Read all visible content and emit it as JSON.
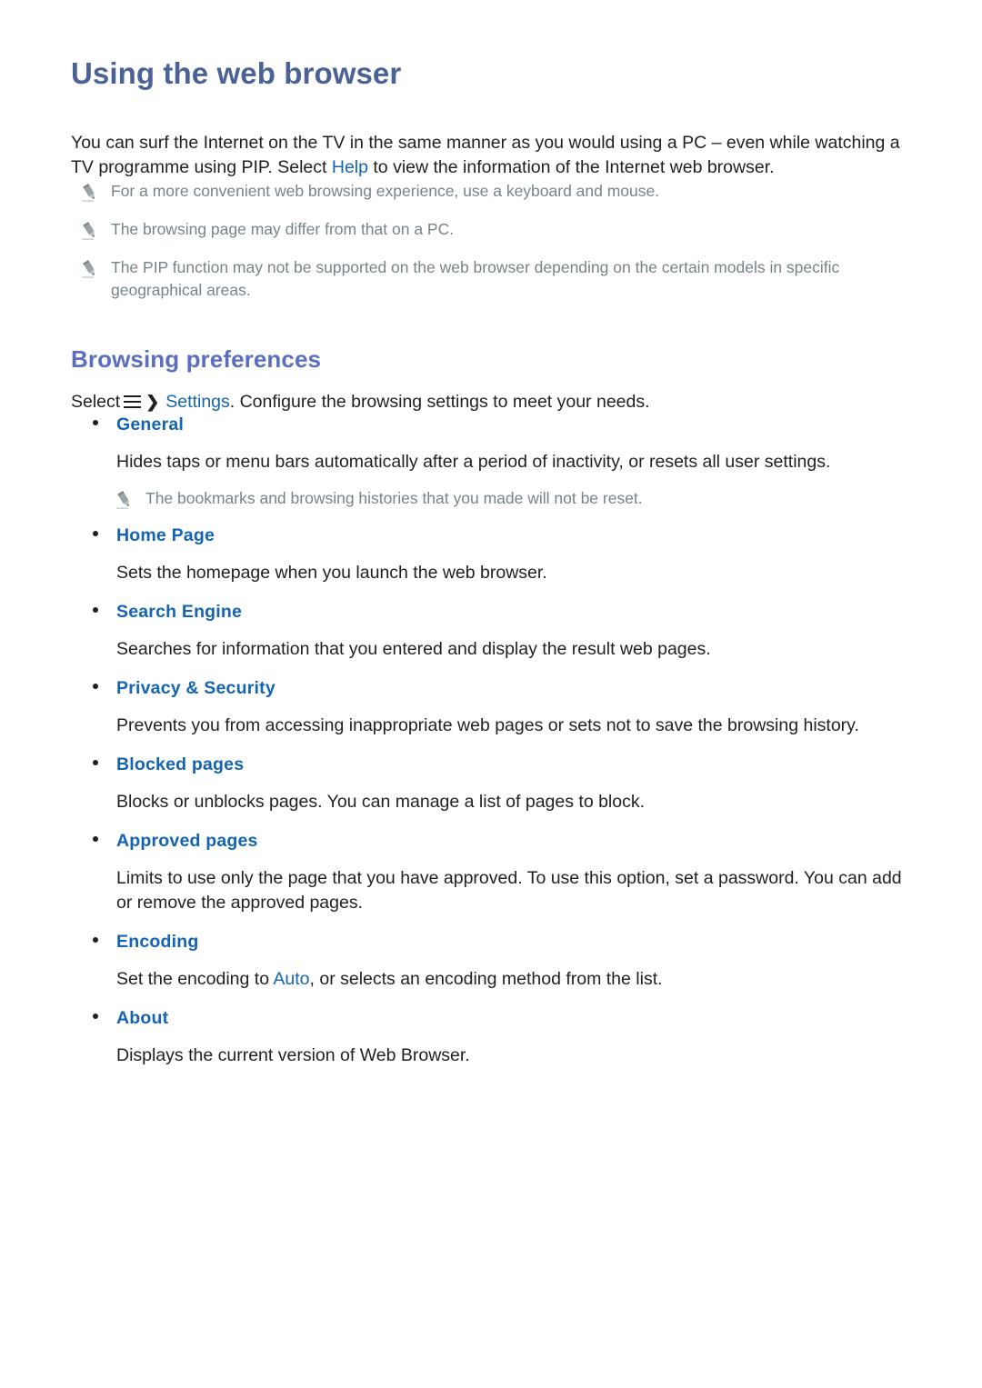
{
  "document": {
    "title": "Using the web browser",
    "intro": {
      "before_link": "You can surf the Internet on the TV in the same manner as you would using a PC – even while watching a TV programme using PIP. Select ",
      "link": "Help",
      "after_link": " to view the information of the Internet web browser."
    },
    "intro_notes": [
      {
        "icon": "pencil-icon",
        "text": "For a more convenient web browsing experience, use a keyboard and mouse."
      },
      {
        "icon": "pencil-icon",
        "text": "The browsing page may differ from that on a PC."
      },
      {
        "icon": "pencil-icon",
        "text": "The PIP function may not be supported on the web browser depending on the certain models in specific geographical areas."
      }
    ],
    "section": {
      "heading": "Browsing preferences",
      "lead": {
        "prefix": "Select",
        "menu_icon": "hamburger-menu-icon",
        "chevron": "❯",
        "link": "Settings",
        "suffix": ". Configure the browsing settings to meet your needs."
      },
      "items": [
        {
          "label": "General",
          "description": "Hides taps or menu bars automatically after a period of inactivity, or resets all user settings.",
          "note": "The bookmarks and browsing histories that you made will not be reset."
        },
        {
          "label": "Home Page",
          "description": "Sets the homepage when you launch the web browser."
        },
        {
          "label": "Search Engine",
          "description": "Searches for information that you entered and display the result web pages."
        },
        {
          "label": "Privacy & Security",
          "description": "Prevents you from accessing inappropriate web pages or sets not to save the browsing history."
        },
        {
          "label": "Blocked pages",
          "description": "Blocks or unblocks pages. You can manage a list of pages to block."
        },
        {
          "label": "Approved pages",
          "description": "Limits to use only the page that you have approved. To use this option, set a password. You can add or remove the approved pages."
        },
        {
          "label": "Encoding",
          "description_before": "Set the encoding to ",
          "description_link": "Auto",
          "description_after": ", or selects an encoding method from the list."
        },
        {
          "label": "About",
          "description": "Displays the current version of Web Browser."
        }
      ]
    }
  },
  "colors": {
    "title_blue": "#4a6296",
    "section_blue": "#5b6fc0",
    "link_blue": "#1464b4",
    "body_text": "#231f20",
    "note_text": "#76848a"
  }
}
